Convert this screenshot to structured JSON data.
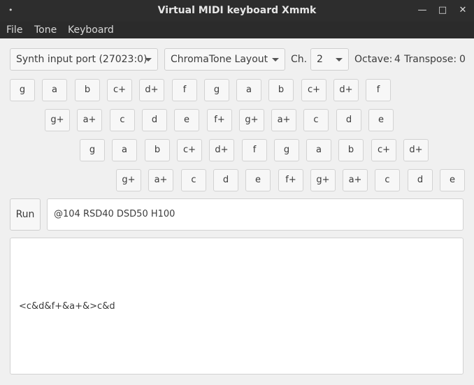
{
  "window": {
    "title": "Virtual MIDI keyboard Xmmk",
    "close": "✕",
    "maximize": "□",
    "minimize": "—"
  },
  "menu": {
    "file": "File",
    "tone": "Tone",
    "keyboard": "Keyboard"
  },
  "toolbar": {
    "port": "Synth input port (27023:0)",
    "layout": "ChromaTone Layout",
    "channel_label": "Ch.",
    "channel": "2",
    "octave_label": "Octave:",
    "octave": "4",
    "transpose_label": "Transpose:",
    "transpose": "0"
  },
  "keyboard_rows": [
    [
      "g",
      "a",
      "b",
      "c+",
      "d+",
      "f",
      "g",
      "a",
      "b",
      "c+",
      "d+",
      "f"
    ],
    [
      "g+",
      "a+",
      "c",
      "d",
      "e",
      "f+",
      "g+",
      "a+",
      "c",
      "d",
      "e"
    ],
    [
      "g",
      "a",
      "b",
      "c+",
      "d+",
      "f",
      "g",
      "a",
      "b",
      "c+",
      "d+"
    ],
    [
      "g+",
      "a+",
      "c",
      "d",
      "e",
      "f+",
      "g+",
      "a+",
      "c",
      "d",
      "e"
    ]
  ],
  "run_label": "Run",
  "command_value": "@104 RSD40 DSD50 H100",
  "output_text": "<c&d&f+&a+&>c&d"
}
